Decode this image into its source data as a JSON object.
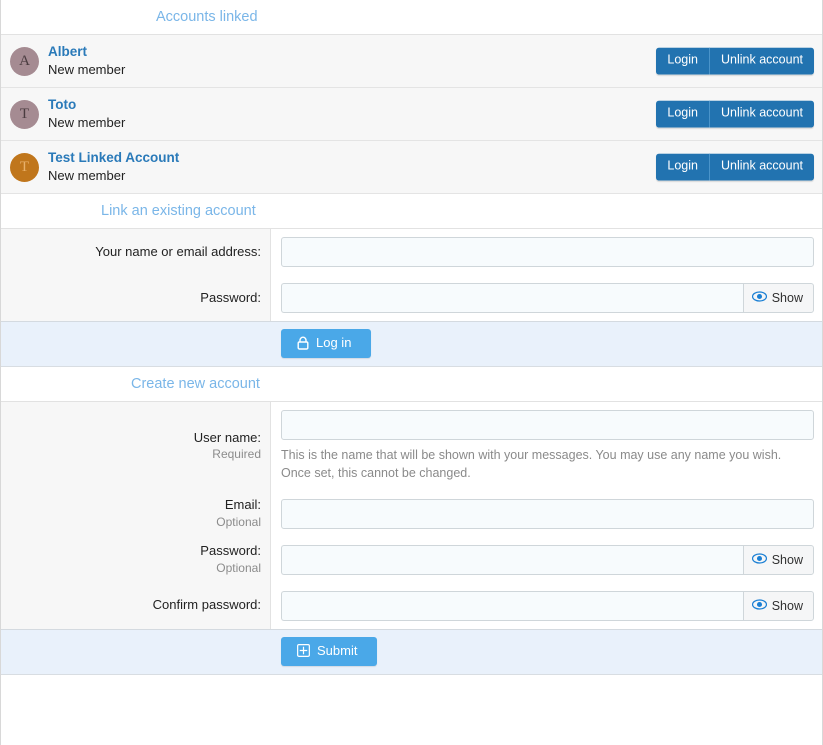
{
  "sections": {
    "accounts_linked_title": "Accounts linked",
    "link_existing_title": "Link an existing account",
    "create_account_title": "Create new account"
  },
  "linked_accounts": [
    {
      "initial": "A",
      "name": "Albert",
      "status": "New member",
      "avatar_bg": "#a58b92",
      "avatar_fg": "#4a3c40",
      "login_label": "Login",
      "unlink_label": "Unlink account"
    },
    {
      "initial": "T",
      "name": "Toto",
      "status": "New member",
      "avatar_bg": "#a58b92",
      "avatar_fg": "#4a3c40",
      "login_label": "Login",
      "unlink_label": "Unlink account"
    },
    {
      "initial": "T",
      "name": "Test Linked Account",
      "status": "New member",
      "avatar_bg": "#c0761c",
      "avatar_fg": "#e8b06a",
      "login_label": "Login",
      "unlink_label": "Unlink account"
    }
  ],
  "login_form": {
    "name_label": "Your name or email address:",
    "name_value": "",
    "name_placeholder": "",
    "password_label": "Password:",
    "password_value": "",
    "password_placeholder": "",
    "show_label": "Show",
    "submit_label": "Log in"
  },
  "create_form": {
    "username_label": "User name:",
    "username_sub": "Required",
    "username_value": "",
    "username_placeholder": "",
    "username_help": "This is the name that will be shown with your messages. You may use any name you wish. Once set, this cannot be changed.",
    "email_label": "Email:",
    "email_sub": "Optional",
    "email_value": "",
    "email_placeholder": "",
    "password_label": "Password:",
    "password_sub": "Optional",
    "password_value": "",
    "password_placeholder": "",
    "confirm_label": "Confirm password:",
    "confirm_value": "",
    "confirm_placeholder": "",
    "show_label": "Show",
    "submit_label": "Submit"
  },
  "colors": {
    "header_blue": "#7ab6e8",
    "link_blue": "#2a7ab9",
    "button_blue": "#2273b0",
    "primary_blue": "#4aa8e8",
    "action_bar_bg": "#e9f1fb",
    "row_bg": "#f7f7f7",
    "input_bg": "#f7fbfd"
  }
}
